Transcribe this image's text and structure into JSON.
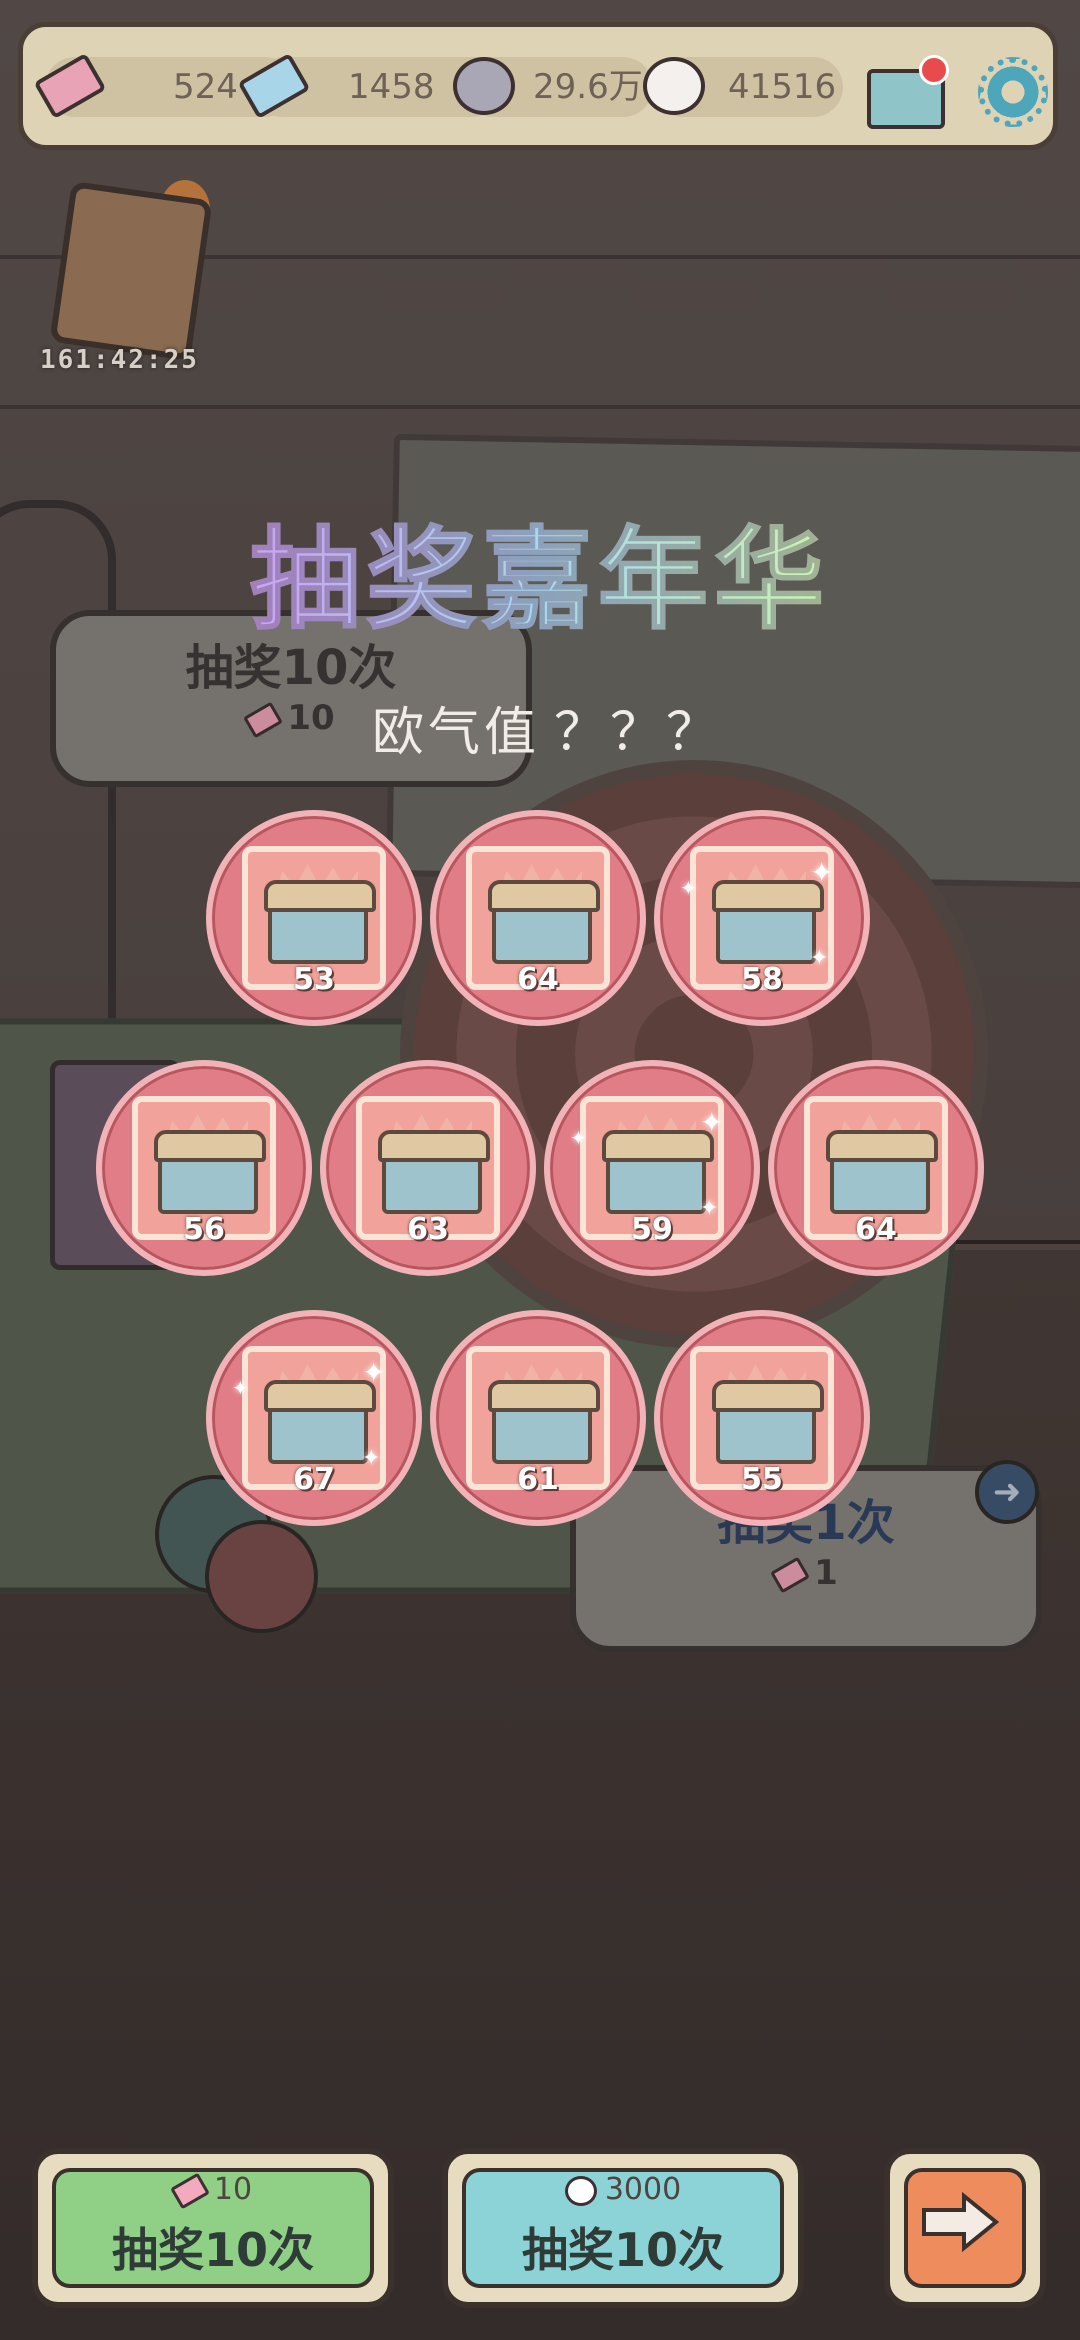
{
  "resources": [
    {
      "name": "pink-ticket",
      "value": "524"
    },
    {
      "name": "blue-ticket",
      "value": "1458"
    },
    {
      "name": "grey-bubble",
      "value": "29.6万"
    },
    {
      "name": "white-bubble",
      "value": "41516"
    }
  ],
  "event": {
    "timer": "161:42:25"
  },
  "title": "抽奖嘉年华",
  "luck": {
    "label": "欧气值",
    "value": "？？？"
  },
  "background_buttons": {
    "draw10": {
      "label": "抽奖10次",
      "cost": "10"
    },
    "draw1": {
      "label": "抽奖1次",
      "cost": "1"
    }
  },
  "prizes": [
    {
      "count": "53",
      "sparkle": false
    },
    {
      "count": "64",
      "sparkle": false
    },
    {
      "count": "58",
      "sparkle": true
    },
    {
      "count": "56",
      "sparkle": false
    },
    {
      "count": "63",
      "sparkle": false
    },
    {
      "count": "59",
      "sparkle": true
    },
    {
      "count": "64",
      "sparkle": false
    },
    {
      "count": "67",
      "sparkle": true
    },
    {
      "count": "61",
      "sparkle": false
    },
    {
      "count": "55",
      "sparkle": false
    }
  ],
  "buttons": {
    "ticket_draw": {
      "cost": "10",
      "label": "抽奖10次"
    },
    "bubble_draw": {
      "cost": "3000",
      "label": "抽奖10次"
    }
  },
  "colors": {
    "accent_green": "#8fcf86",
    "accent_blue": "#8cd3d8",
    "accent_orange": "#ee8c5d",
    "prize_pink": "#e07d86"
  }
}
